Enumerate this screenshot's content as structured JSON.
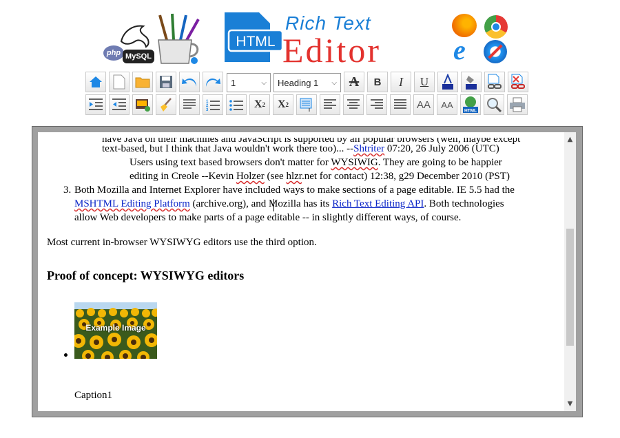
{
  "banner": {
    "php_label": "php",
    "mysql_label": "MySQL",
    "html_badge": "HTML",
    "title_top": "Rich Text",
    "title_main": "Editor"
  },
  "toolbar": {
    "row1": {
      "font_size_value": "1",
      "format_value": "Heading 1",
      "text_color_label": "A",
      "bold_label": "B",
      "italic_label": "I",
      "underline_label": "U"
    },
    "row2": {
      "subscript_label": "X",
      "subscript_sub": "2",
      "superscript_label": "X",
      "superscript_sup": "2",
      "increase_font_label": "AA",
      "decrease_font_label": "AA",
      "html_label": "HTML"
    }
  },
  "document": {
    "line_cut": "have Java on their machines and JavaScript is supported by all popular browsers (well, maybe except",
    "line1_pre": "text-based, but I think that Java wouldn't work there too)... --",
    "line1_link": "Shtriter",
    "line1_post": " 07:20, 26 July 2006 (UTC)",
    "line2_pre": "Users using text based browsers don't matter for ",
    "line2_word": "WYSIWIG",
    "line2_post": ". They are going to be happier",
    "line3_pre": "editing in Creole --Kevin ",
    "line3_word1": "Holzer",
    "line3_mid": " (see ",
    "line3_word2": "hlzr",
    "line3_post": ".net for contact) 12:38, g29 December 2010 (PST)",
    "item3_marker": "3.",
    "item3_line1": "Both Mozilla and Internet Explorer have included ways to make sections of a page editable. IE 5.5 had the",
    "item3_link1": "MSHTML Editing Platform",
    "item3_mid": " (archive.org), and Mozilla has its ",
    "item3_link2": "Rich Text Editing API",
    "item3_post": ". Both technologies",
    "item3_line3": "allow Web developers to make parts of a page editable -- in slightly different ways, of course.",
    "paragraph": "Most current in-browser WYSIWYG editors use the third option.",
    "heading": "Proof of concept: WYSIWYG editors",
    "image_overlay": "Example Image",
    "caption": "Caption1"
  },
  "colors": {
    "link": "#0b25c8",
    "title_blue": "#1a7fd6",
    "title_red": "#e3322e",
    "frame_gray": "#a0a0a0"
  }
}
